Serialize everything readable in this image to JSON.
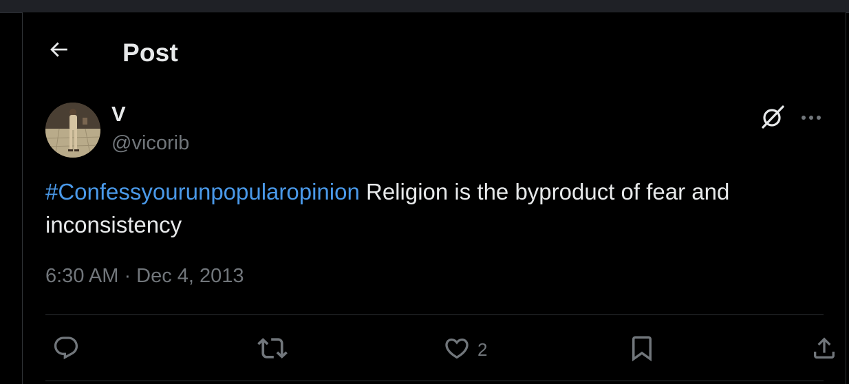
{
  "header": {
    "title": "Post",
    "back_icon": "arrow-left-icon"
  },
  "post": {
    "author": {
      "display_name": "V",
      "handle": "@vicorib"
    },
    "text": {
      "hashtag": "#Confessyourunpopularopinion",
      "body": " Religion is the byproduct of fear and inconsistency"
    },
    "timestamp": "6:30 AM · Dec 4, 2013",
    "actions": {
      "reply_count": "",
      "repost_count": "",
      "like_count": "2",
      "bookmark_count": ""
    }
  },
  "colors": {
    "background": "#000000",
    "text": "#e7e9ea",
    "secondary_text": "#71767b",
    "link": "#4a99e9",
    "divider": "#2f3336"
  },
  "icons": [
    "arrow-left-icon",
    "grok-icon",
    "more-icon",
    "reply-icon",
    "repost-icon",
    "like-icon",
    "bookmark-icon",
    "share-icon"
  ]
}
